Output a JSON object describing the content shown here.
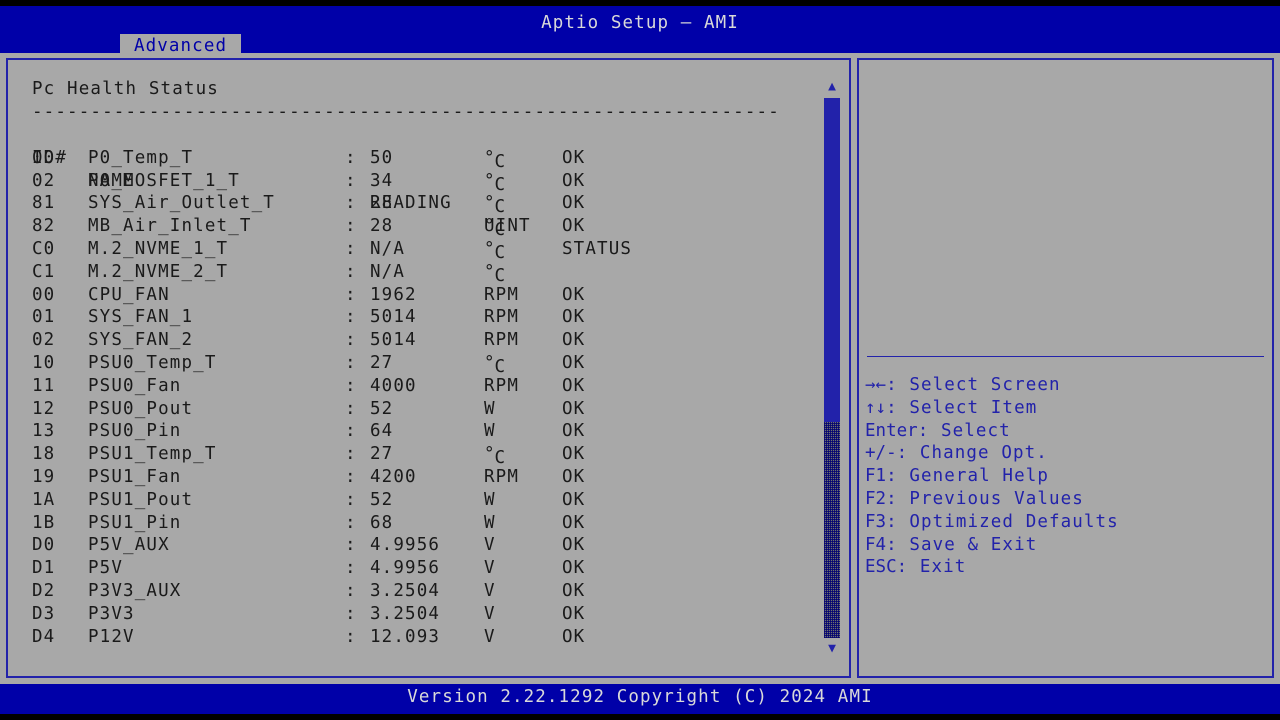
{
  "window": {
    "title": "Aptio Setup – AMI",
    "colors": {
      "header_blue": "#0000a8",
      "panel_gray": "#a8a8a8",
      "border_blue": "#2222aa",
      "text_dark": "#1a1a1a",
      "text_light": "#d9d9d9",
      "help_blue": "#2222aa"
    }
  },
  "menubar": {
    "tabs": [
      {
        "label": "Advanced",
        "active": true
      }
    ]
  },
  "main": {
    "section_title": "Pc Health Status",
    "divider": "----------------------------------------------------------------",
    "columns": {
      "id": "ID#",
      "name": "NAME",
      "reading": "READING",
      "unit": "UINT",
      "status": "STATUS"
    },
    "colon": ":",
    "rows": [
      {
        "id": "00",
        "name": "P0_Temp_T",
        "reading": "50",
        "unit": "°C",
        "status": "OK"
      },
      {
        "id": "02",
        "name": "P0_MOSFET_1_T",
        "reading": "34",
        "unit": "°C",
        "status": "OK"
      },
      {
        "id": "81",
        "name": "SYS_Air_Outlet_T",
        "reading": "28",
        "unit": "°C",
        "status": "OK"
      },
      {
        "id": "82",
        "name": "MB_Air_Inlet_T",
        "reading": "28",
        "unit": "°C",
        "status": "OK"
      },
      {
        "id": "C0",
        "name": "M.2_NVME_1_T",
        "reading": "N/A",
        "unit": "°C",
        "status": ""
      },
      {
        "id": "C1",
        "name": "M.2_NVME_2_T",
        "reading": "N/A",
        "unit": "°C",
        "status": ""
      },
      {
        "id": "00",
        "name": "CPU_FAN",
        "reading": "1962",
        "unit": "RPM",
        "status": "OK"
      },
      {
        "id": "01",
        "name": "SYS_FAN_1",
        "reading": "5014",
        "unit": "RPM",
        "status": "OK"
      },
      {
        "id": "02",
        "name": "SYS_FAN_2",
        "reading": "5014",
        "unit": "RPM",
        "status": "OK"
      },
      {
        "id": "10",
        "name": "PSU0_Temp_T",
        "reading": "27",
        "unit": "°C",
        "status": "OK"
      },
      {
        "id": "11",
        "name": "PSU0_Fan",
        "reading": "4000",
        "unit": "RPM",
        "status": "OK"
      },
      {
        "id": "12",
        "name": "PSU0_Pout",
        "reading": "52",
        "unit": "W",
        "status": "OK"
      },
      {
        "id": "13",
        "name": "PSU0_Pin",
        "reading": "64",
        "unit": "W",
        "status": "OK"
      },
      {
        "id": "18",
        "name": "PSU1_Temp_T",
        "reading": "27",
        "unit": "°C",
        "status": "OK"
      },
      {
        "id": "19",
        "name": "PSU1_Fan",
        "reading": "4200",
        "unit": "RPM",
        "status": "OK"
      },
      {
        "id": "1A",
        "name": "PSU1_Pout",
        "reading": "52",
        "unit": "W",
        "status": "OK"
      },
      {
        "id": "1B",
        "name": "PSU1_Pin",
        "reading": "68",
        "unit": "W",
        "status": "OK"
      },
      {
        "id": "D0",
        "name": "P5V_AUX",
        "reading": "4.9956",
        "unit": "V",
        "status": "OK"
      },
      {
        "id": "D1",
        "name": "P5V",
        "reading": "4.9956",
        "unit": "V",
        "status": "OK"
      },
      {
        "id": "D2",
        "name": "P3V3_AUX",
        "reading": "3.2504",
        "unit": "V",
        "status": "OK"
      },
      {
        "id": "D3",
        "name": "P3V3",
        "reading": "3.2504",
        "unit": "V",
        "status": "OK"
      },
      {
        "id": "D4",
        "name": "P12V",
        "reading": "12.093",
        "unit": "V",
        "status": "OK"
      }
    ]
  },
  "scrollbar": {
    "up_arrow": "▲",
    "down_arrow": "▼",
    "thumb_fraction": "60%"
  },
  "help": {
    "items": [
      {
        "keys": "→←",
        "text": ": Select Screen"
      },
      {
        "keys": "↑↓",
        "text": ": Select Item"
      },
      {
        "keys": "Enter",
        "text": ": Select"
      },
      {
        "keys": "+/-",
        "text": ": Change Opt."
      },
      {
        "keys": "F1",
        "text": ": General Help"
      },
      {
        "keys": "F2",
        "text": ": Previous Values"
      },
      {
        "keys": "F3",
        "text": ": Optimized Defaults"
      },
      {
        "keys": "F4",
        "text": ": Save & Exit"
      },
      {
        "keys": "ESC",
        "text": ": Exit"
      }
    ]
  },
  "footer": {
    "version": "Version 2.22.1292 Copyright (C) 2024 AMI"
  }
}
